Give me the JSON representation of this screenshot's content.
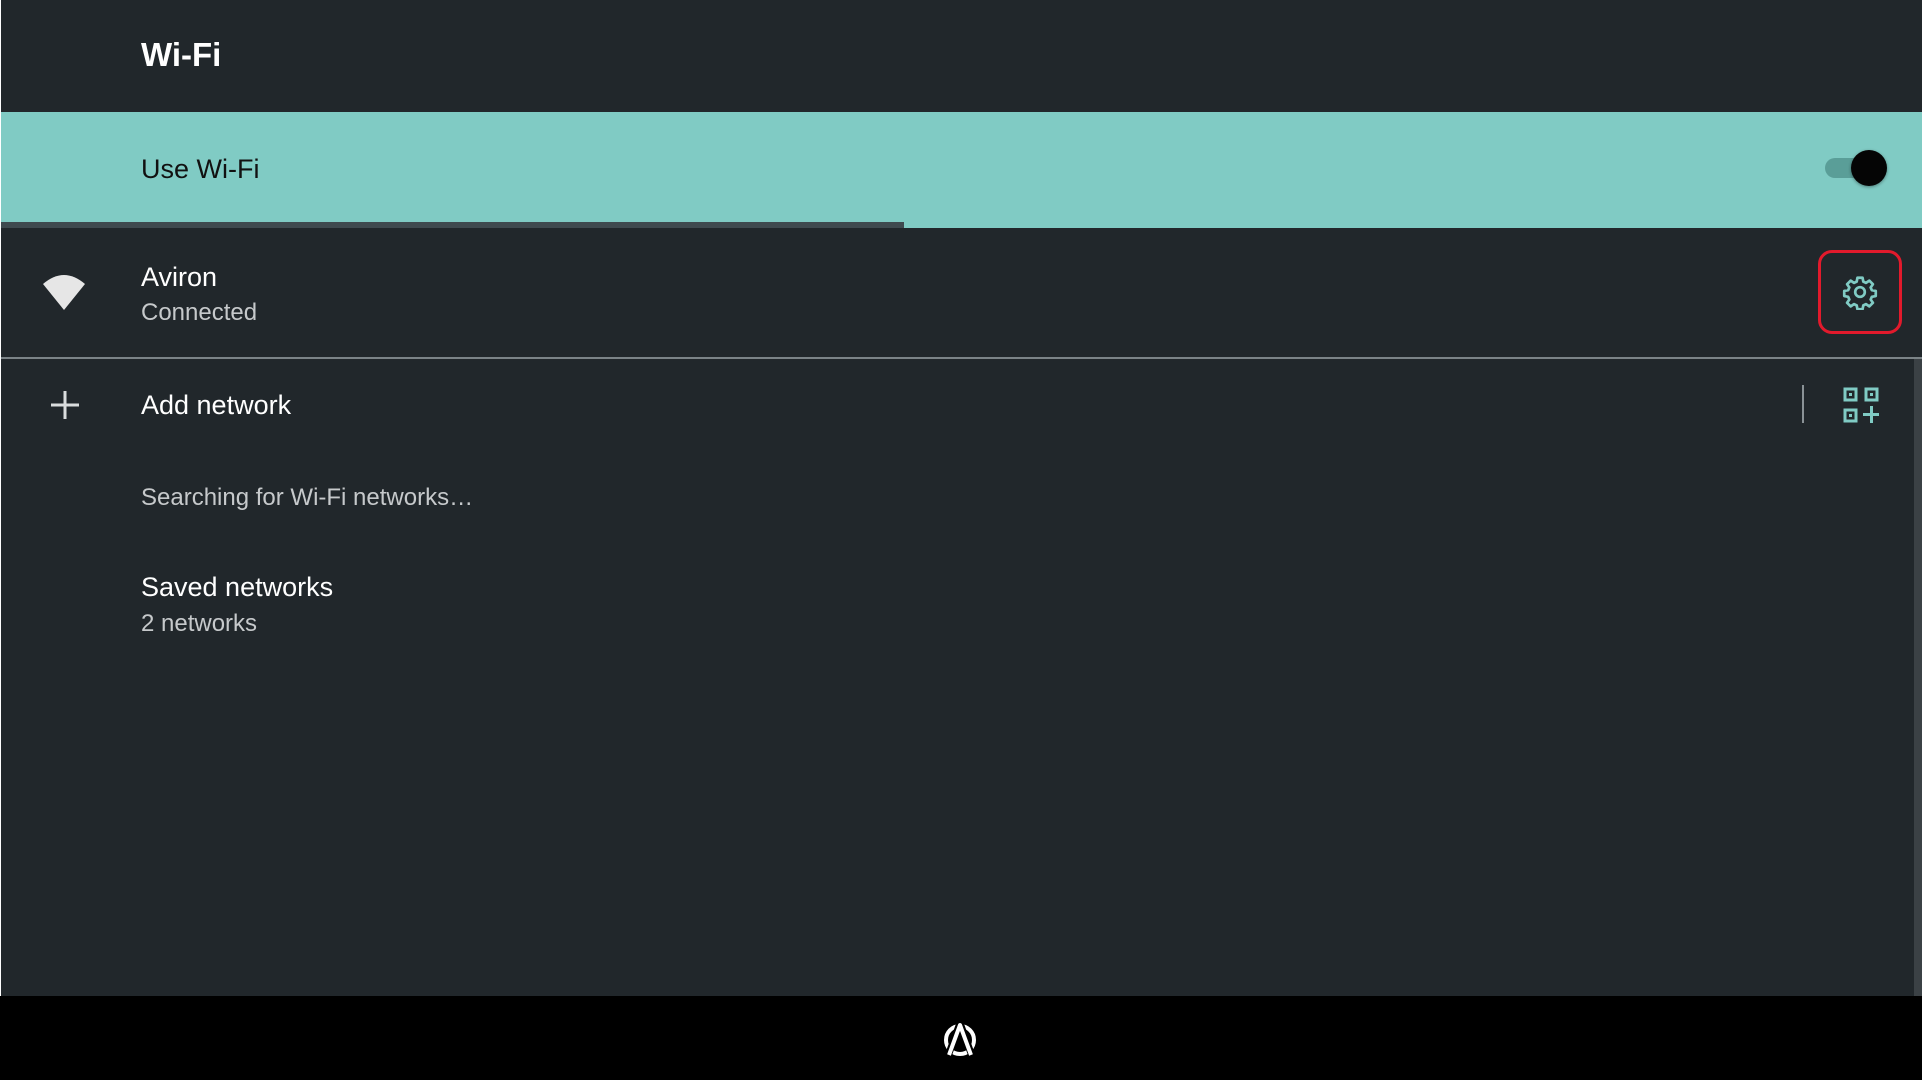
{
  "header": {
    "title": "Wi-Fi"
  },
  "use_wifi": {
    "label": "Use Wi-Fi",
    "enabled": true,
    "accent_color": "#80cbc4",
    "scan_progress": 0.47
  },
  "connected_network": {
    "name": "Aviron",
    "status": "Connected",
    "signal_icon": "wifi-signal-icon",
    "settings_icon": "gear-icon",
    "highlight_color": "#e21a2c"
  },
  "add_network": {
    "label": "Add network",
    "icon": "plus-icon",
    "qr_icon": "qr-code-scan-icon"
  },
  "status_message": "Searching for Wi-Fi networks…",
  "saved_networks": {
    "title": "Saved networks",
    "count_text": "2 networks"
  },
  "nav": {
    "logo_icon": "aviron-logo-icon"
  }
}
